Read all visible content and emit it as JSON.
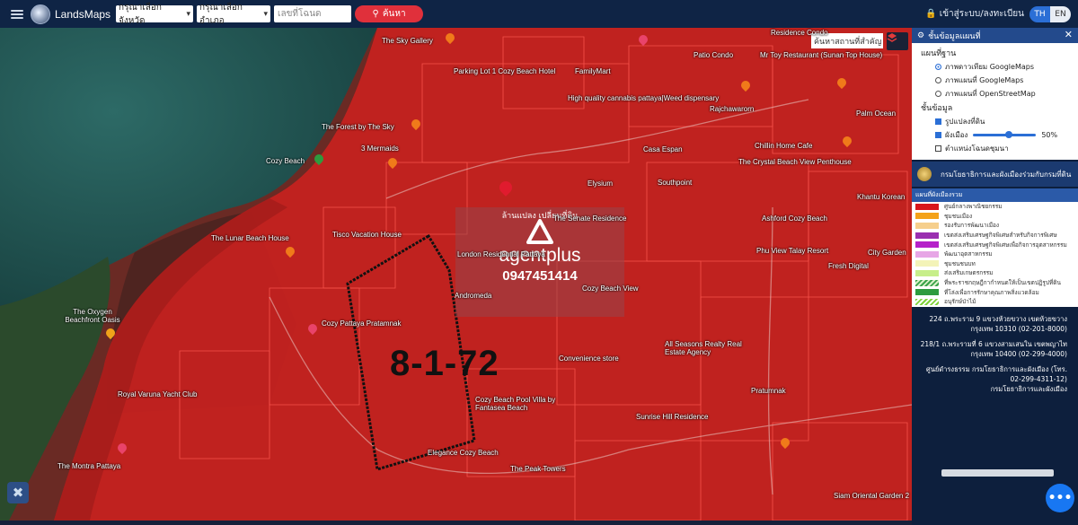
{
  "topbar": {
    "brand": "LandsMaps",
    "province_select": "กรุณาเลือกจังหวัด",
    "district_select": "กรุณาเลือกอำเภอ",
    "deed_placeholder": "เลขที่โฉนด",
    "search_label": "ค้นหา",
    "login_label": "เข้าสู่ระบบ/ลงทะเบียน",
    "lang_th": "TH",
    "lang_en": "EN"
  },
  "map": {
    "search_placeholder": "ค้นหาสถานที่สำคัญ",
    "watermark_tag": "ล้านแปลง เปลี่ยนที่ดิน",
    "watermark_brand": "agentplus",
    "watermark_phone": "0947451414",
    "plot_number": "8-1-72",
    "labels": [
      "The Sky Gallery",
      "Parking Lot 1 Cozy Beach Hotel",
      "FamilyMart",
      "High quality cannabis pattaya|Weed dispensary",
      "Patio Condo",
      "Mr Toy Restaurant (Sunan Top House)",
      "Residence Condo",
      "Rajchawarorn",
      "Palm Ocean",
      "The Forest by The Sky",
      "3 Mermaids",
      "Cozy Beach",
      "Chillin Home Cafe",
      "Casa Espan",
      "The Crystal Beach View Penthouse",
      "Elysium",
      "Southpoint",
      "Khantu Korean",
      "The Senate Residence",
      "Ashford Cozy Beach",
      "City Garden",
      "The Lunar Beach House",
      "Tisco Vacation House",
      "London Residential Pattaya",
      "Phu View Talay Resort",
      "Fresh Digital",
      "Andromeda",
      "Cozy Beach View",
      "The Oxygen Beachfront Oasis",
      "Cozy Pattaya Pratamnak",
      "All Seasons Realty Real Estate Agency",
      "Royal Varuna Yacht Club",
      "Convenience store",
      "Pratumnak",
      "Cozy Beach Pool Villa by Fantasea Beach",
      "Sunrise Hill Residence",
      "Elegance Cozy Beach",
      "The Peak Towers",
      "The Montra Pattaya",
      "Siam Oriental Garden 2"
    ]
  },
  "panel": {
    "title": "ชั้นข้อมูลแผนที่",
    "basemap_heading": "แผนที่ฐาน",
    "basemaps": [
      {
        "label": "ภาพดาวเทียม GoogleMaps",
        "selected": true
      },
      {
        "label": "ภาพแผนที่ GoogleMaps",
        "selected": false
      },
      {
        "label": "ภาพแผนที่ OpenStreetMap",
        "selected": false
      }
    ],
    "layers_heading": "ชั้นข้อมูล",
    "layers": [
      {
        "label": "รูปแปลงที่ดิน",
        "checked": true
      },
      {
        "label": "ผังเมือง",
        "checked": true,
        "opacity": "50%"
      },
      {
        "label": "ตำแหน่งโฉนดชุมนา",
        "checked": false
      }
    ],
    "dept_name": "กรมโยธาธิการและผังเมืองร่วมกับกรมที่ดิน",
    "legend_heading": "แผนที่ผังเมืองรวม",
    "legend": [
      {
        "label": "ศูนย์กลางพาณิชยกรรม",
        "color": "#d8161c"
      },
      {
        "label": "ชุมชนเมือง",
        "color": "#f4a21a"
      },
      {
        "label": "รองรับการพัฒนาเมือง",
        "color": "#f6cf8c"
      },
      {
        "label": "เขตส่งเสริมเศรษฐกิจพิเศษสำหรับกิจการพิเศษ",
        "color": "#9a2fb0"
      },
      {
        "label": "เขตส่งเสริมเศรษฐกิจพิเศษเพื่อกิจการอุตสาหกรรม",
        "color": "#b521c9"
      },
      {
        "label": "พัฒนาอุตสาหกรรม",
        "color": "#e7a6e6"
      },
      {
        "label": "ชุมชนชนบท",
        "color": "#f3f3b8"
      },
      {
        "label": "ส่งเสริมเกษตรกรรม",
        "color": "#c7ee8a"
      },
      {
        "label": "ที่พระราชกฤษฎีกากำหนดให้เป็นเขตปฏิรูปที่ดิน",
        "color": "hatch-green"
      },
      {
        "label": "ที่โล่งเพื่อการรักษาคุณภาพสิ่งแวดล้อม",
        "color": "#2e9b3e"
      },
      {
        "label": "อนุรักษ์ป่าไม้",
        "color": "hatch-lime"
      }
    ],
    "addresses": [
      "224 ถ.พระราม 9 แขวงห้วยขวาง เขตห้วยขวาง กรุงเทพ 10310 (02-201-8000)",
      "218/1 ถ.พระรามที่ 6 แขวงสามเสนใน เขตพญาไท กรุงเทพ 10400 (02-299-4000)",
      "ศูนย์ดำรงธรรม กรมโยธาธิการและผังเมือง (โทร. 02-299-4311-12)",
      "กรมโยธาธิการและผังเมือง"
    ]
  },
  "icons": {
    "menu": "menu-icon",
    "search": "search-icon",
    "lock": "lock-icon",
    "layers": "layers-icon",
    "close": "close-icon",
    "tool": "tool-icon",
    "chat": "chat-icon"
  }
}
